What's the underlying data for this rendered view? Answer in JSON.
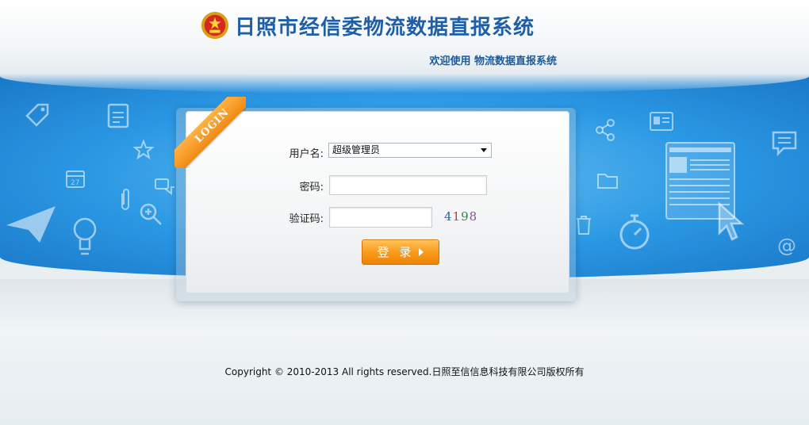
{
  "header": {
    "title": "日照市经信委物流数据直报系统",
    "welcome": "欢迎使用 物流数据直报系统"
  },
  "login": {
    "ribbon_text": "LOGIN",
    "username_label": "用户名:",
    "username_value": "超级管理员",
    "password_label": "密码:",
    "captcha_label": "验证码:",
    "captcha_digits": [
      "4",
      "1",
      "9",
      "8"
    ],
    "captcha_colors": [
      "#2a5fb0",
      "#c83a2a",
      "#2a8a3a",
      "#8a4a9a"
    ],
    "submit_label": "登 录"
  },
  "footer": {
    "copyright": "Copyright © 2010-2013 All rights reserved.日照至信信息科技有限公司版权所有"
  },
  "colors": {
    "brand_blue": "#1f5fa8",
    "band_blue": "#2b98e4",
    "button_orange": "#f99b1c"
  },
  "icons": [
    "emblem-icon",
    "tag-icon",
    "clipboard-icon",
    "star-icon",
    "calendar-icon",
    "paperclip-icon",
    "chat-icon",
    "paper-plane-icon",
    "zoom-in-icon",
    "lightbulb-icon",
    "share-icon",
    "id-card-icon",
    "folder-icon",
    "trash-icon",
    "stopwatch-icon",
    "message-icon",
    "at-icon",
    "cursor-icon",
    "dashboard-thumbnail-icon"
  ]
}
